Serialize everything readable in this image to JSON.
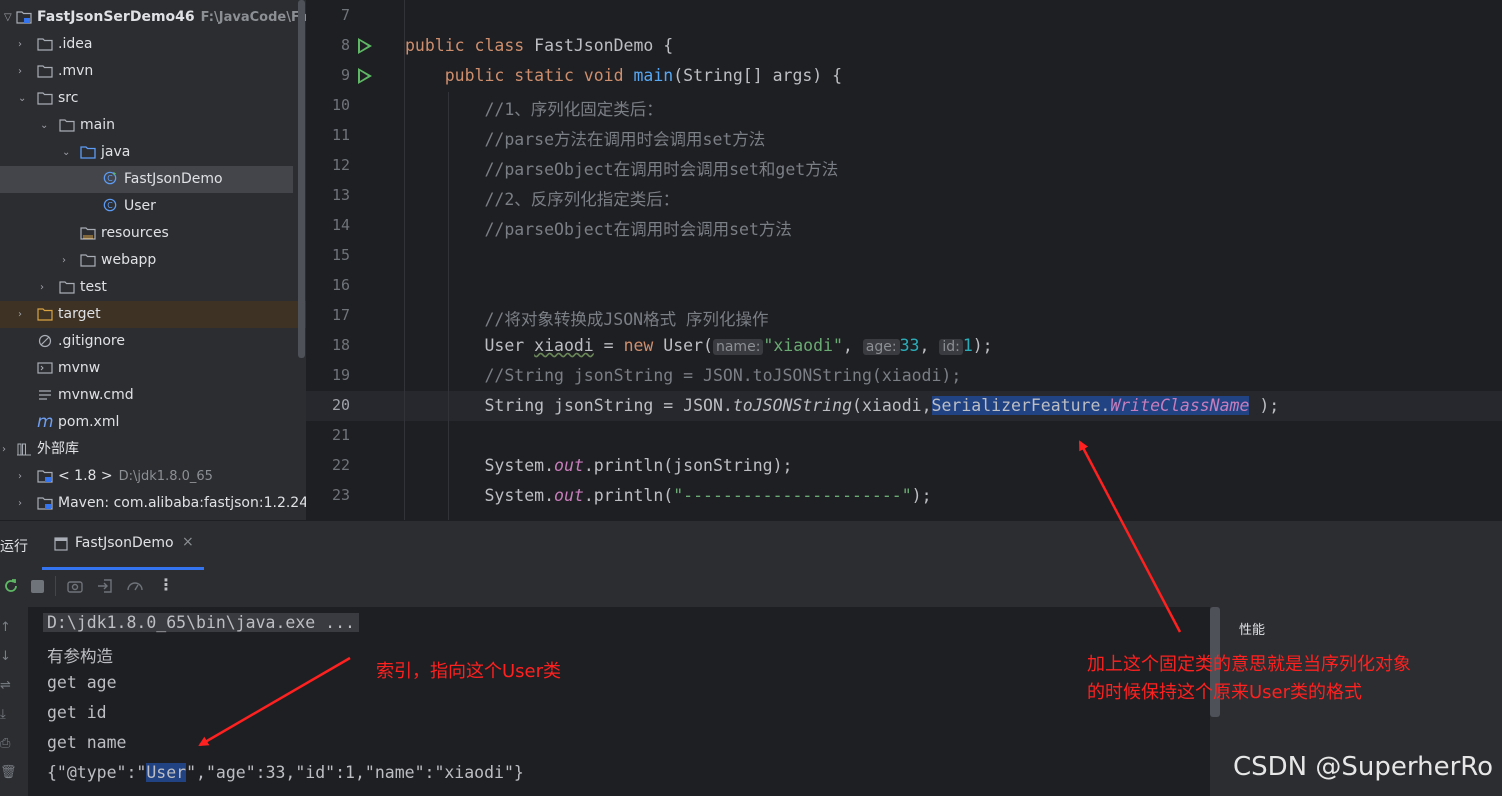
{
  "project": {
    "root_name": "FastJsonSerDemo46",
    "root_path": "F:\\JavaCode\\FastJs",
    "items": [
      {
        "label": ".idea"
      },
      {
        "label": ".mvn"
      },
      {
        "label": "src"
      },
      {
        "label": "main"
      },
      {
        "label": "java"
      },
      {
        "label": "FastJsonDemo"
      },
      {
        "label": "User"
      },
      {
        "label": "resources"
      },
      {
        "label": "webapp"
      },
      {
        "label": "test"
      },
      {
        "label": "target"
      },
      {
        "label": ".gitignore"
      },
      {
        "label": "mvnw"
      },
      {
        "label": "mvnw.cmd"
      },
      {
        "label": "pom.xml"
      },
      {
        "label": "外部库"
      },
      {
        "label": "< 1.8 >",
        "path": "D:\\jdk1.8.0_65"
      },
      {
        "label": "Maven: com.alibaba:fastjson:1.2.24"
      }
    ]
  },
  "editor": {
    "line_numbers": [
      "7",
      "8",
      "9",
      "10",
      "11",
      "12",
      "13",
      "14",
      "15",
      "16",
      "17",
      "18",
      "19",
      "20",
      "21",
      "22",
      "23"
    ],
    "current_line": "20",
    "lines": {
      "l8_a": "public class ",
      "l8_b": "FastJsonDemo {",
      "l9_a": "    public static void ",
      "l9_b": "main",
      "l9_c": "(String[] args) {",
      "l10": "        //1、序列化固定类后：",
      "l11": "        //parse方法在调用时会调用set方法",
      "l12": "        //parseObject在调用时会调用set和get方法",
      "l13": "        //2、反序列化指定类后：",
      "l14": "        //parseObject在调用时会调用set方法",
      "l17": "        //将对象转换成JSON格式 序列化操作",
      "l18_a": "        User ",
      "l18_b": "xiaodi",
      "l18_c": " = ",
      "l18_d": "new",
      "l18_e": " User(",
      "l18_hint_name": "name:",
      "l18_str": "\"xiaodi\"",
      "l18_f": ", ",
      "l18_hint_age": "age:",
      "l18_age": "33",
      "l18_g": ", ",
      "l18_hint_id": "id:",
      "l18_id": "1",
      "l18_h": ");",
      "l19": "        //String jsonString = JSON.toJSONString(xiaodi);",
      "l20_a": "        String jsonString = JSON.",
      "l20_b": "toJSONString",
      "l20_c": "(xiaodi,",
      "l20_sel1": "SerializerFeature.",
      "l20_sel2": "WriteClassName",
      "l20_d": " );",
      "l22_a": "        System.",
      "l22_b": "out",
      "l22_c": ".println(jsonString);",
      "l23_a": "        System.",
      "l23_b": "out",
      "l23_c": ".println(",
      "l23_str": "\"----------------------\"",
      "l23_d": ");"
    }
  },
  "run": {
    "title": "运行",
    "tab_label": "FastJsonDemo",
    "console": {
      "cmd": "D:\\jdk1.8.0_65\\bin\\java.exe ...",
      "line1": "有参构造",
      "line2": "get age",
      "line3": "get id",
      "line4": "get name",
      "json_a": "{\"@type\":\"",
      "json_sel": "User",
      "json_b": "\",\"age\":33,\"id\":1,\"name\":\"xiaodi\"}"
    },
    "perf_label": "性能"
  },
  "annotations": {
    "left": "索引，指向这个User类",
    "right_line1": "加上这个固定类的意思就是当序列化对象",
    "right_line2": "的时候保持这个原来User类的格式"
  },
  "watermark": "CSDN @SuperherRo",
  "colors": {
    "annotation": "#ff2020",
    "selection": "#214283",
    "run_icon": "#5fb865"
  }
}
